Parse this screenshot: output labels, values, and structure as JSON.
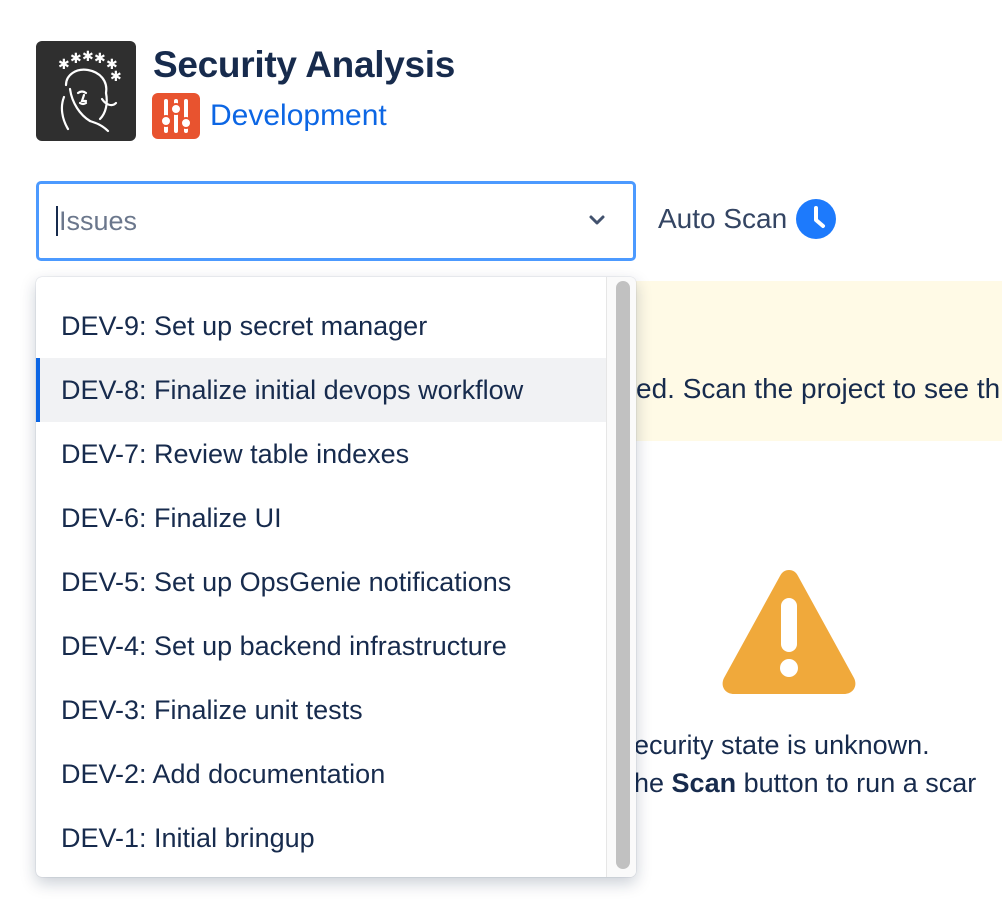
{
  "header": {
    "title": "Security Analysis",
    "project_name": "Development"
  },
  "issue_select": {
    "placeholder": "Issues"
  },
  "auto_scan": {
    "label": "Auto Scan"
  },
  "banner": {
    "text_visible": "ed. Scan the project to see th"
  },
  "empty_state": {
    "line1": "ecurity state is unknown.",
    "line2_prefix": "he ",
    "line2_bold": "Scan",
    "line2_suffix": " button to run a scar"
  },
  "dropdown": {
    "options": [
      "DEV-9: Set up secret manager",
      "DEV-8: Finalize initial devops workflow",
      "DEV-7: Review table indexes",
      "DEV-6: Finalize UI",
      "DEV-5: Set up OpsGenie notifications",
      "DEV-4: Set up backend infrastructure",
      "DEV-3: Finalize unit tests",
      "DEV-2: Add documentation",
      "DEV-1: Initial bringup"
    ],
    "highlighted": "DEV-8: Finalize initial devops workflow"
  },
  "colors": {
    "accent": "#0c66e4",
    "focus_border": "#4c9aff",
    "banner_bg": "#fffae6",
    "warning": "#f0a93b",
    "project_icon": "#e8532f"
  }
}
